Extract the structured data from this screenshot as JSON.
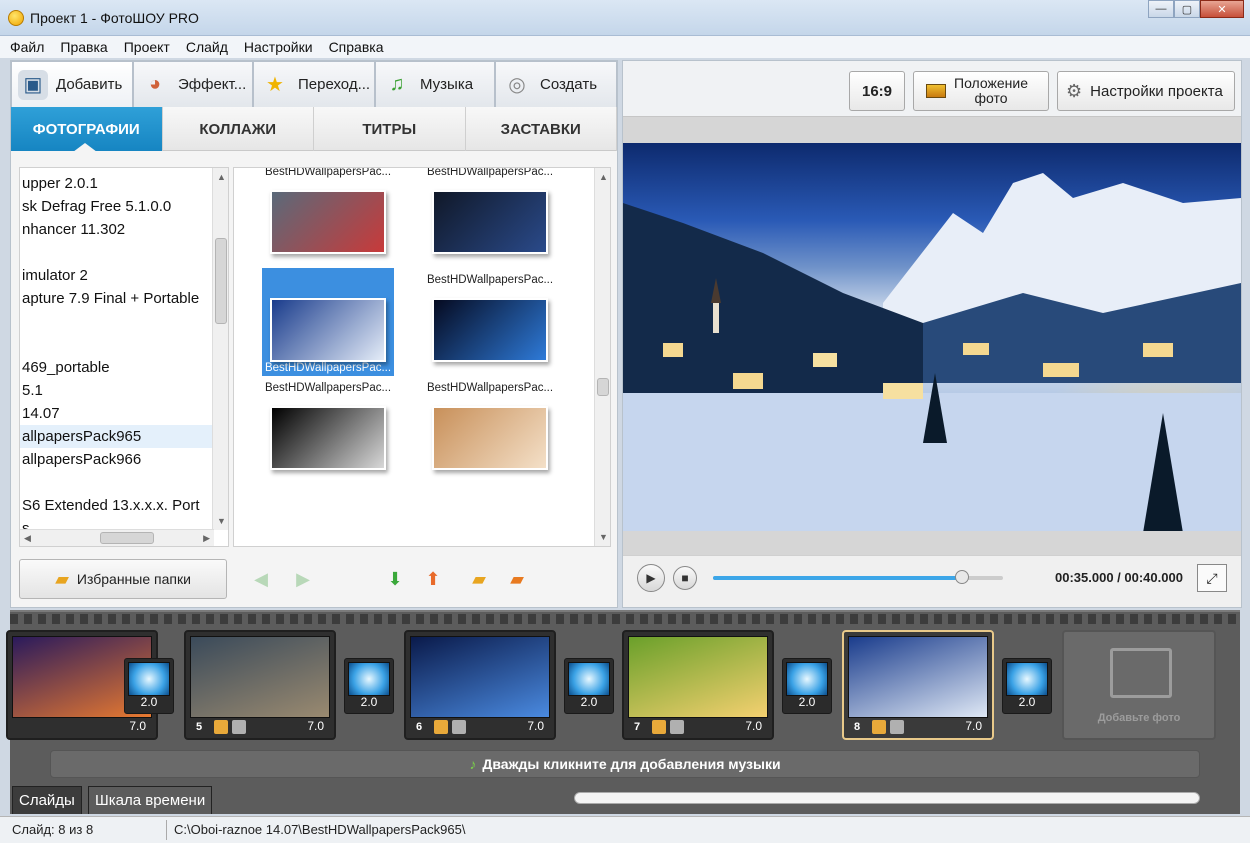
{
  "window": {
    "title": "Проект 1 - ФотоШОУ PRO"
  },
  "menu": [
    "Файл",
    "Правка",
    "Проект",
    "Слайд",
    "Настройки",
    "Справка"
  ],
  "main_tabs": [
    {
      "label": "Добавить",
      "icon": "camera-icon"
    },
    {
      "label": "Эффект...",
      "icon": "palette-icon"
    },
    {
      "label": "Переход...",
      "icon": "star-icon"
    },
    {
      "label": "Музыка",
      "icon": "music-note-icon"
    },
    {
      "label": "Создать",
      "icon": "disc-icon"
    }
  ],
  "sub_tabs": [
    "ФОТОГРАФИИ",
    "КОЛЛАЖИ",
    "ТИТРЫ",
    "ЗАСТАВКИ"
  ],
  "folders": [
    "upper 2.0.1",
    "sk Defrag Free 5.1.0.0",
    "nhancer 11.302",
    "",
    "imulator 2",
    "apture 7.9 Final + Portable",
    "",
    "",
    "469_portable",
    "5.1",
    "14.07",
    "allpapersPack965",
    "allpapersPack966",
    "",
    "S6 Extended 13.x.x.x. Port",
    "s"
  ],
  "thumbnails": {
    "caption": "BestHDWallpapersPac...",
    "colors": [
      [
        "#5a6a7a",
        "#c83a3a"
      ],
      [
        "#101828",
        "#2a4a8a"
      ],
      [
        "#1a3c8c",
        "#e4ecf8"
      ],
      [
        "#050a20",
        "#2e7ad8"
      ],
      [
        "#000000",
        "#d8d8d8"
      ],
      [
        "#c8905a",
        "#f4e0c8"
      ]
    ]
  },
  "left_bottom": {
    "favorites_label": "Избранные папки"
  },
  "toolbar": {
    "ratio": "16:9",
    "position_line1": "Положение",
    "position_line2": "фото",
    "settings": "Настройки проекта"
  },
  "player": {
    "time": "00:35.000 / 00:40.000",
    "progress": 0.86
  },
  "slides": [
    {
      "num": "",
      "dur": "7.0",
      "colors": [
        "#2a1a5c",
        "#e87a30"
      ]
    },
    {
      "num": "5",
      "dur": "7.0",
      "colors": [
        "#3a4a5a",
        "#9a8a70"
      ]
    },
    {
      "num": "6",
      "dur": "7.0",
      "colors": [
        "#0a1a4a",
        "#4a8ae0"
      ]
    },
    {
      "num": "7",
      "dur": "7.0",
      "colors": [
        "#6aa02a",
        "#f4d070"
      ]
    },
    {
      "num": "8",
      "dur": "7.0",
      "colors": [
        "#1a3c8c",
        "#dfe8f5"
      ]
    }
  ],
  "transitions": [
    {
      "dur": "2.0"
    },
    {
      "dur": "2.0"
    },
    {
      "dur": "2.0"
    },
    {
      "dur": "2.0"
    },
    {
      "dur": "2.0"
    }
  ],
  "add_photo": {
    "label": "Добавьте фото"
  },
  "music_bar": {
    "label": "Дважды кликните для добавления музыки"
  },
  "bottom_tabs": {
    "slides": "Слайды",
    "timeline": "Шкала времени"
  },
  "status": {
    "slide": "Слайд: 8 из 8",
    "path": "C:\\Oboi-raznoe 14.07\\BestHDWallpapersPack965\\"
  }
}
